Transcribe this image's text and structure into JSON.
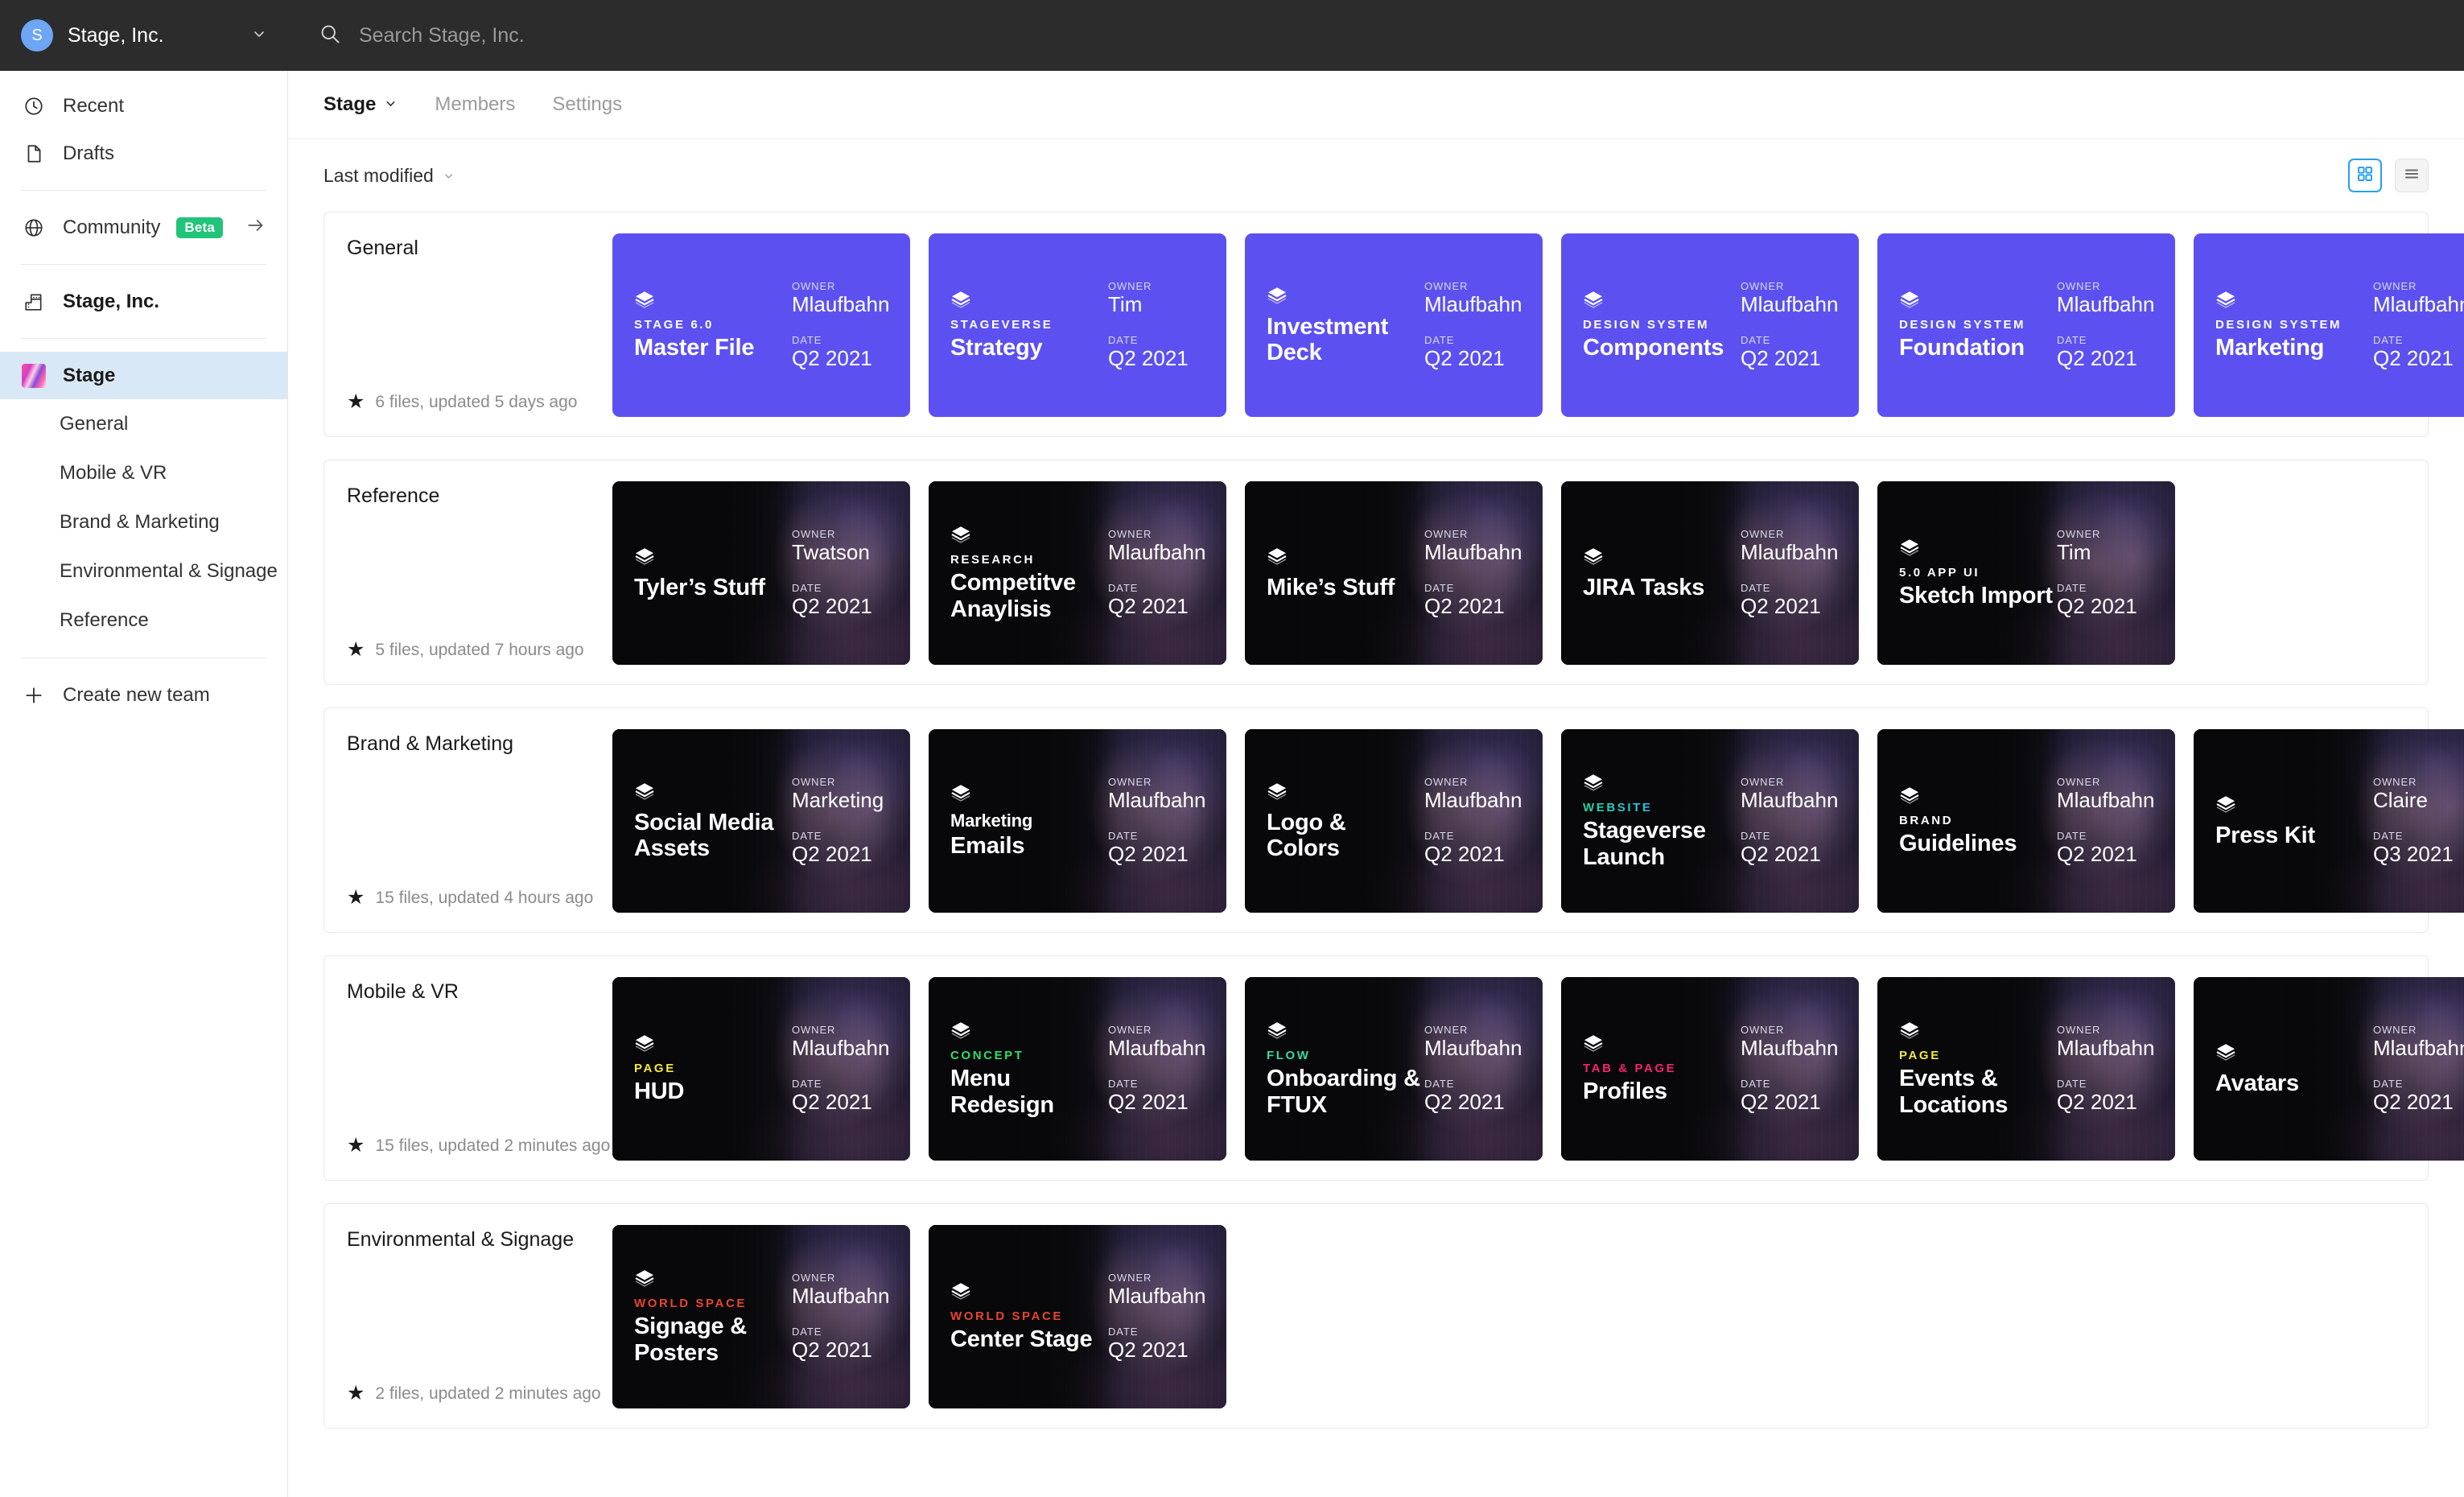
{
  "topbar": {
    "org_initial": "S",
    "org_name": "Stage, Inc.",
    "search_placeholder": "Search Stage, Inc.",
    "search_value": ""
  },
  "sidebar": {
    "items": [
      {
        "label": "Recent",
        "icon": "clock-icon"
      },
      {
        "label": "Drafts",
        "icon": "file-icon"
      }
    ],
    "community": {
      "label": "Community",
      "badge": "Beta",
      "icon": "globe-icon"
    },
    "org": {
      "label": "Stage, Inc.",
      "icon": "building-icon"
    },
    "team": {
      "label": "Stage",
      "icon": "team-thumbnail"
    },
    "projects": [
      "General",
      "Mobile & VR",
      "Brand & Marketing",
      "Environmental & Signage",
      "Reference"
    ],
    "create_team": {
      "label": "Create new team",
      "icon": "plus-icon"
    }
  },
  "main": {
    "tabs": [
      {
        "label": "Stage",
        "active": true,
        "caret": true
      },
      {
        "label": "Members",
        "active": false,
        "caret": false
      },
      {
        "label": "Settings",
        "active": false,
        "caret": false
      }
    ],
    "toolbar": {
      "sort_label": "Last modified",
      "grid_view_icon": "grid-view-icon",
      "list_view_icon": "list-view-icon",
      "active_view": "grid"
    },
    "sections": [
      {
        "title": "General",
        "summary": "6 files, updated 5 days ago",
        "theme": "purple",
        "files": [
          {
            "eyebrow": "STAGE 6.0",
            "eyebrow_color": "#ffffff",
            "title": "Master File",
            "owner_label": "OWNER",
            "owner": "Mlaufbahn",
            "date_label": "DATE",
            "date": "Q2 2021"
          },
          {
            "eyebrow": "STAGEVERSE",
            "eyebrow_color": "#ffffff",
            "title": "Strategy",
            "owner_label": "OWNER",
            "owner": "Tim",
            "date_label": "DATE",
            "date": "Q2 2021"
          },
          {
            "eyebrow": "",
            "eyebrow_color": "#ffffff",
            "title": "Investment Deck",
            "owner_label": "OWNER",
            "owner": "Mlaufbahn",
            "date_label": "DATE",
            "date": "Q2 2021"
          },
          {
            "eyebrow": "DESIGN SYSTEM",
            "eyebrow_color": "#ffffff",
            "title": "Components",
            "owner_label": "OWNER",
            "owner": "Mlaufbahn",
            "date_label": "DATE",
            "date": "Q2 2021"
          },
          {
            "eyebrow": "DESIGN SYSTEM",
            "eyebrow_color": "#ffffff",
            "title": "Foundation",
            "owner_label": "OWNER",
            "owner": "Mlaufbahn",
            "date_label": "DATE",
            "date": "Q2 2021"
          },
          {
            "eyebrow": "DESIGN SYSTEM",
            "eyebrow_color": "#ffffff",
            "title": "Marketing",
            "owner_label": "OWNER",
            "owner": "Mlaufbahn",
            "date_label": "DATE",
            "date": "Q2 2021"
          }
        ]
      },
      {
        "title": "Reference",
        "summary": "5 files, updated 7 hours ago",
        "theme": "dark",
        "files": [
          {
            "eyebrow": "",
            "eyebrow_color": "#ffffff",
            "title": "Tyler’s Stuff",
            "owner_label": "OWNER",
            "owner": "Twatson",
            "date_label": "DATE",
            "date": "Q2 2021"
          },
          {
            "eyebrow": "RESEARCH",
            "eyebrow_color": "#ffffff",
            "title": "Competitve Anaylisis",
            "owner_label": "OWNER",
            "owner": "Mlaufbahn",
            "date_label": "DATE",
            "date": "Q2 2021"
          },
          {
            "eyebrow": "",
            "eyebrow_color": "#ffffff",
            "title": "Mike’s Stuff",
            "owner_label": "OWNER",
            "owner": "Mlaufbahn",
            "date_label": "DATE",
            "date": "Q2 2021"
          },
          {
            "eyebrow": "",
            "eyebrow_color": "#ffffff",
            "title": "JIRA Tasks",
            "owner_label": "OWNER",
            "owner": "Mlaufbahn",
            "date_label": "DATE",
            "date": "Q2 2021"
          },
          {
            "eyebrow": "5.0 APP UI",
            "eyebrow_color": "#ffffff",
            "title": "Sketch Import",
            "owner_label": "OWNER",
            "owner": "Tim",
            "date_label": "DATE",
            "date": "Q2 2021"
          }
        ]
      },
      {
        "title": "Brand & Marketing",
        "summary": "15 files, updated 4 hours ago",
        "theme": "dark",
        "files": [
          {
            "eyebrow": "",
            "eyebrow_color": "#ffffff",
            "title": "Social Media Assets",
            "owner_label": "OWNER",
            "owner": "Marketing",
            "date_label": "DATE",
            "date": "Q2 2021"
          },
          {
            "eyebrow": "Marketing",
            "eyebrow_color": "#ffffff",
            "eyebrow_style": "title",
            "title": "Emails",
            "owner_label": "OWNER",
            "owner": "Mlaufbahn",
            "date_label": "DATE",
            "date": "Q2 2021"
          },
          {
            "eyebrow": "",
            "eyebrow_color": "#ffffff",
            "title": "Logo & Colors",
            "owner_label": "OWNER",
            "owner": "Mlaufbahn",
            "date_label": "DATE",
            "date": "Q2 2021"
          },
          {
            "eyebrow": "WEBSITE",
            "eyebrow_color": "gradient",
            "title": "Stageverse Launch",
            "owner_label": "OWNER",
            "owner": "Mlaufbahn",
            "date_label": "DATE",
            "date": "Q2 2021"
          },
          {
            "eyebrow": "BRAND",
            "eyebrow_color": "#ffffff",
            "title": "Guidelines",
            "owner_label": "OWNER",
            "owner": "Mlaufbahn",
            "date_label": "DATE",
            "date": "Q2 2021"
          },
          {
            "eyebrow": "",
            "eyebrow_color": "#ffffff",
            "title": "Press Kit",
            "owner_label": "OWNER",
            "owner": "Claire",
            "date_label": "DATE",
            "date": "Q3 2021"
          }
        ]
      },
      {
        "title": "Mobile & VR",
        "summary": "15 files, updated 2 minutes ago",
        "theme": "dark",
        "files": [
          {
            "eyebrow": "PAGE",
            "eyebrow_color": "#f2e843",
            "title": "HUD",
            "owner_label": "OWNER",
            "owner": "Mlaufbahn",
            "date_label": "DATE",
            "date": "Q2 2021"
          },
          {
            "eyebrow": "CONCEPT",
            "eyebrow_color": "#2fdd6c",
            "title": "Menu Redesign",
            "owner_label": "OWNER",
            "owner": "Mlaufbahn",
            "date_label": "DATE",
            "date": "Q2 2021"
          },
          {
            "eyebrow": "FLOW",
            "eyebrow_color": "#2fdd9c",
            "title": "Onboarding & FTUX",
            "owner_label": "OWNER",
            "owner": "Mlaufbahn",
            "date_label": "DATE",
            "date": "Q2 2021"
          },
          {
            "eyebrow": "TAB & PAGE",
            "eyebrow_color": "#f5246f",
            "title": "Profiles",
            "owner_label": "OWNER",
            "owner": "Mlaufbahn",
            "date_label": "DATE",
            "date": "Q2 2021"
          },
          {
            "eyebrow": "PAGE",
            "eyebrow_color": "#f2e843",
            "title": "Events & Locations",
            "owner_label": "OWNER",
            "owner": "Mlaufbahn",
            "date_label": "DATE",
            "date": "Q2 2021"
          },
          {
            "eyebrow": "",
            "eyebrow_color": "#ffffff",
            "title": "Avatars",
            "owner_label": "OWNER",
            "owner": "Mlaufbahn",
            "date_label": "DATE",
            "date": "Q2 2021"
          }
        ]
      },
      {
        "title": "Environmental & Signage",
        "summary": "2 files, updated 2 minutes ago",
        "theme": "dark",
        "files": [
          {
            "eyebrow": "WORLD SPACE",
            "eyebrow_color": "#e8442f",
            "title": "Signage & Posters",
            "owner_label": "OWNER",
            "owner": "Mlaufbahn",
            "date_label": "DATE",
            "date": "Q2 2021"
          },
          {
            "eyebrow": "WORLD SPACE",
            "eyebrow_color": "#e8442f",
            "title": "Center Stage",
            "owner_label": "OWNER",
            "owner": "Mlaufbahn",
            "date_label": "DATE",
            "date": "Q2 2021"
          }
        ]
      }
    ]
  },
  "colors": {
    "accent_blue": "#27a0ef",
    "card_purple": "#5c51f0",
    "card_dark": "#0d0d0f",
    "beta_green": "#21c47a",
    "topbar": "#2c2c2c",
    "selected_nav": "#d9e8f7"
  }
}
